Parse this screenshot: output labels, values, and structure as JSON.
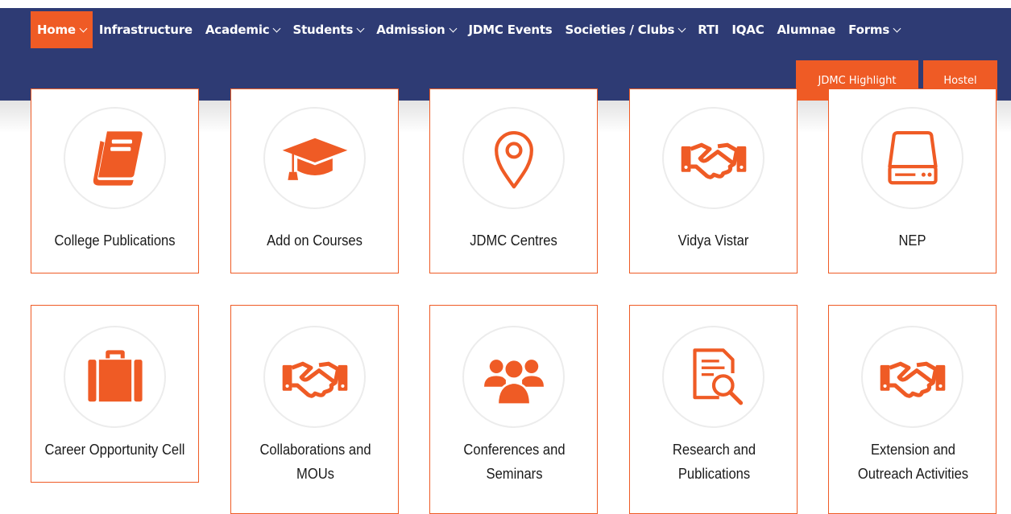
{
  "nav": {
    "items": [
      {
        "label": "Home",
        "dropdown": true,
        "active": true
      },
      {
        "label": "Infrastructure",
        "dropdown": false,
        "active": false
      },
      {
        "label": "Academic",
        "dropdown": true,
        "active": false
      },
      {
        "label": "Students",
        "dropdown": true,
        "active": false
      },
      {
        "label": "Admission",
        "dropdown": true,
        "active": false
      },
      {
        "label": "JDMC Events",
        "dropdown": false,
        "active": false
      },
      {
        "label": "Societies / Clubs",
        "dropdown": true,
        "active": false
      },
      {
        "label": "RTI",
        "dropdown": false,
        "active": false
      },
      {
        "label": "IQAC",
        "dropdown": false,
        "active": false
      },
      {
        "label": "Alumnae",
        "dropdown": false,
        "active": false
      },
      {
        "label": "Forms",
        "dropdown": true,
        "active": false
      }
    ],
    "sub_buttons": [
      {
        "label": "JDMC Highlight"
      },
      {
        "label": "Hostel"
      }
    ]
  },
  "colors": {
    "navy": "#2e3b74",
    "accent": "#ef5b25",
    "card_border": "#ef5b25",
    "text": "#1a1a1a"
  },
  "cards": [
    {
      "label": "College Publications",
      "icon": "book-icon"
    },
    {
      "label": "Add on Courses",
      "icon": "graduation-cap-icon"
    },
    {
      "label": "JDMC Centres",
      "icon": "map-pin-icon"
    },
    {
      "label": "Vidya Vistar",
      "icon": "handshake-icon"
    },
    {
      "label": "NEP",
      "icon": "hard-drive-icon"
    },
    {
      "label": "Career Opportunity Cell",
      "icon": "briefcase-icon"
    },
    {
      "label": "Collaborations and MOUs",
      "icon": "handshake-icon"
    },
    {
      "label": "Conferences and Seminars",
      "icon": "users-group-icon"
    },
    {
      "label": "Research and Publications",
      "icon": "document-search-icon"
    },
    {
      "label": "Extension and Outreach Activities",
      "icon": "handshake-icon"
    }
  ]
}
